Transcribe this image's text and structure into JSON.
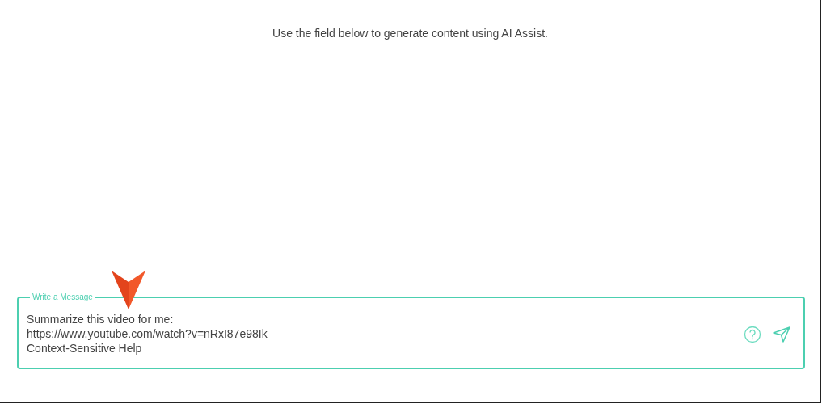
{
  "instruction": "Use the field below to generate content using AI Assist.",
  "message_field": {
    "label": "Write a Message",
    "value_lines": [
      "Summarize this video for me:",
      "https://www.youtube.com/watch?v=nRxI87e98Ik",
      "Context-Sensitive Help"
    ]
  }
}
